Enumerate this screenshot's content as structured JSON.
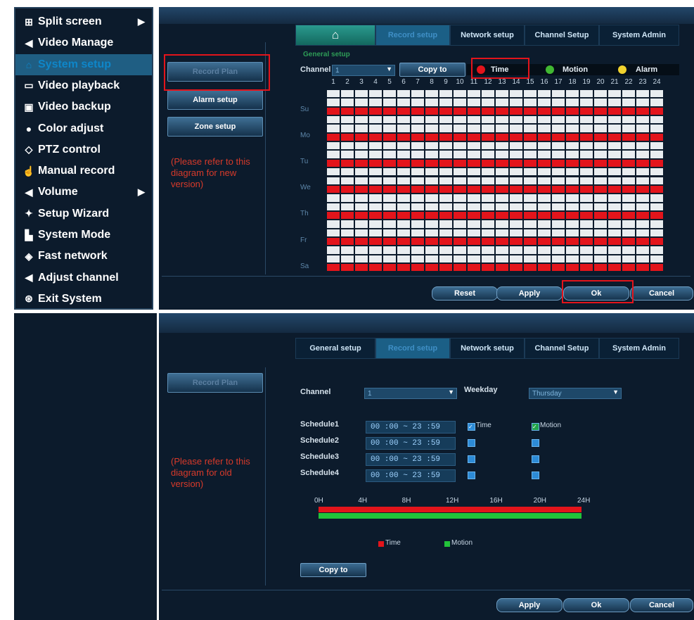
{
  "menu": {
    "items": [
      {
        "icon": "grid-icon",
        "glyph": "⊞",
        "label": "Split screen",
        "arrow": "▶"
      },
      {
        "icon": "video-icon",
        "glyph": "◀",
        "label": "Video Manage"
      },
      {
        "icon": "home-icon",
        "glyph": "⌂",
        "label": "System setup",
        "active": true
      },
      {
        "icon": "playback-icon",
        "glyph": "▭",
        "label": "Video playback"
      },
      {
        "icon": "save-icon",
        "glyph": "▣",
        "label": "Video backup"
      },
      {
        "icon": "color-icon",
        "glyph": "●",
        "label": "Color adjust"
      },
      {
        "icon": "ptz-icon",
        "glyph": "◇",
        "label": "PTZ control"
      },
      {
        "icon": "hand-icon",
        "glyph": "☝",
        "label": "Manual record"
      },
      {
        "icon": "volume-icon",
        "glyph": "◀",
        "label": "Volume",
        "arrow": "▶"
      },
      {
        "icon": "wizard-icon",
        "glyph": "✦",
        "label": "Setup Wizard"
      },
      {
        "icon": "mode-icon",
        "glyph": "▙",
        "label": "System Mode"
      },
      {
        "icon": "network-icon",
        "glyph": "◈",
        "label": "Fast network"
      },
      {
        "icon": "camera-icon",
        "glyph": "◀",
        "label": "Adjust channel"
      },
      {
        "icon": "power-icon",
        "glyph": "⊛",
        "label": "Exit System"
      }
    ]
  },
  "new_version": {
    "tabs": [
      "Record setup",
      "Network setup",
      "Channel Setup",
      "System Admin"
    ],
    "breadcrumb": "General setup",
    "side_buttons": [
      "Record Plan",
      "Alarm setup",
      "Zone setup"
    ],
    "note": "(Please refer to this diagram for new version)",
    "channel_label": "Channel",
    "channel_value": "1",
    "copy_to": "Copy to",
    "legend": [
      {
        "label": "Time",
        "color": "#e3141b"
      },
      {
        "label": "Motion",
        "color": "#41b832"
      },
      {
        "label": "Alarm",
        "color": "#f1d22e"
      }
    ],
    "hours": [
      "1",
      "2",
      "3",
      "4",
      "5",
      "6",
      "7",
      "8",
      "9",
      "10",
      "11",
      "12",
      "13",
      "14",
      "15",
      "16",
      "17",
      "18",
      "19",
      "20",
      "21",
      "22",
      "23",
      "24"
    ],
    "days": [
      "Su",
      "Mo",
      "Tu",
      "We",
      "Th",
      "Fr",
      "Sa"
    ],
    "buttons": [
      "Reset",
      "Apply",
      "Ok",
      "Cancel"
    ]
  },
  "old_version": {
    "tabs": [
      "General setup",
      "Record setup",
      "Network setup",
      "Channel Setup",
      "System Admin"
    ],
    "side_buttons": [
      "Record Plan"
    ],
    "note": "(Please refer to this diagram for old version)",
    "channel_label": "Channel",
    "channel_value": "1",
    "weekday_label": "Weekday",
    "weekday_value": "Thursday",
    "schedules": [
      {
        "label": "Schedule1",
        "time": "00 :00 ~ 23 :59",
        "time_checked": true,
        "motion_checked": true
      },
      {
        "label": "Schedule2",
        "time": "00 :00 ~ 23 :59",
        "time_checked": false,
        "motion_checked": false
      },
      {
        "label": "Schedule3",
        "time": "00 :00 ~ 23 :59",
        "time_checked": false,
        "motion_checked": false
      },
      {
        "label": "Schedule4",
        "time": "00 :00 ~ 23 :59",
        "time_checked": false,
        "motion_checked": false
      }
    ],
    "check_time_label": "Time",
    "check_motion_label": "Motion",
    "timeline_labels": [
      "0H",
      "4H",
      "8H",
      "12H",
      "16H",
      "20H",
      "24H"
    ],
    "legend": [
      {
        "label": "Time",
        "color": "#e3141b"
      },
      {
        "label": "Motion",
        "color": "#22c33a"
      }
    ],
    "copy_to": "Copy to",
    "buttons": [
      "Apply",
      "Ok",
      "Cancel"
    ]
  },
  "colors": {
    "red": "#e3141b",
    "green": "#22c33a",
    "panel": "#0c1b2c",
    "accent": "#1b5f86"
  }
}
